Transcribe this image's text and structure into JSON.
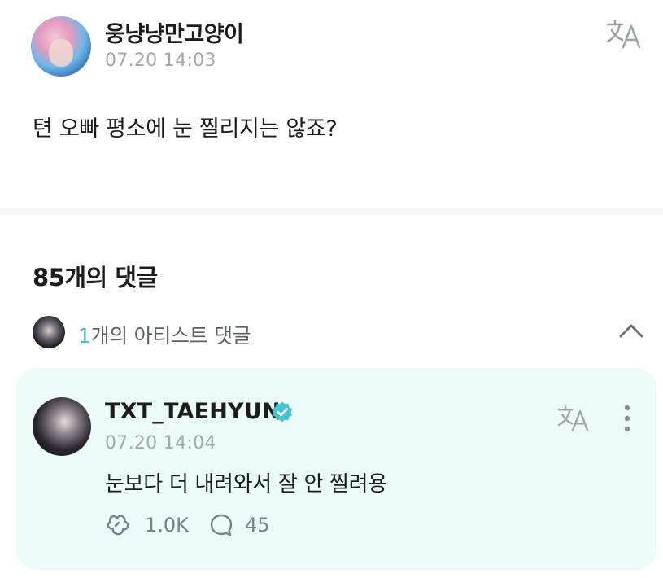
{
  "post": {
    "author_name": "웅냥냥만고양이",
    "time": "07.20 14:03",
    "body": "텬 오빠 평소에 눈 찔리지는 않죠?",
    "translate_icon": "translate-icon"
  },
  "comments": {
    "heading": "85개의 댓글",
    "artist_summary": {
      "count": "1",
      "label": "개의 아티스트 댓글",
      "toggle_icon": "chevron-up-icon"
    },
    "artist_comment": {
      "author_name": "TXT_TAEHYUN",
      "verified_icon": "verified-badge-icon",
      "time": "07.20 14:04",
      "text": "눈보다 더 내려와서 잘 안 찔려용",
      "like_count": "1.0K",
      "reply_count": "45",
      "card_color": "#ebfbf8",
      "accent_color": "#45c3cf"
    }
  }
}
